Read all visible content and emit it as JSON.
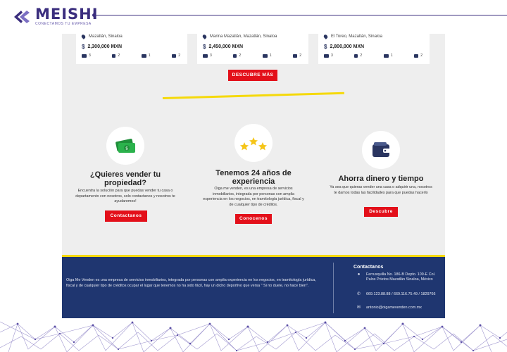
{
  "header": {
    "brand": "MEISHI",
    "tagline": "CONECTAMOS TU EMPRESA"
  },
  "properties": [
    {
      "location": "Mazatlán, Sinaloa",
      "price": "2,300,000 MXN",
      "bedrooms": "3",
      "bathrooms": "2",
      "garage": "1",
      "floors": "2"
    },
    {
      "location": "Marina Mazatlán, Mazatlán, Sinaloa",
      "price": "2,450,000 MXN",
      "bedrooms": "3",
      "bathrooms": "2",
      "garage": "1",
      "floors": "2"
    },
    {
      "location": "El Toreo, Mazatlán, Sinaloa",
      "price": "2,800,000 MXN",
      "bedrooms": "3",
      "bathrooms": "2",
      "garage": "1",
      "floors": "2"
    }
  ],
  "more_button": "DESCUBRE MÁS",
  "features": [
    {
      "icon": "money-icon",
      "title": "¿Quieres vender tu propiedad?",
      "text": "Encuentra la solución para que puedas vender tu casa o departamento con nosotros, solo contactanos y nosotros te ayudaremos!",
      "button": "Contactanos"
    },
    {
      "icon": "stars-icon",
      "title": "Tenemos 24 años de experiencia",
      "text": "Oiga me venden, es una empresa de servicios inmobiliarios, integrada por personas con amplia experiencia en los negocios, en tramitología jurídica, fiscal y de cualquier tipo de créditos.",
      "button": "Conocenos"
    },
    {
      "icon": "wallet-icon",
      "title": "Ahorra dinero y tiempo",
      "text": "Ya sea que quieras vender una casa o adquirir una, nosotros te damos todas las facilidades para que puedas hacerlo",
      "button": "Descubre"
    }
  ],
  "footer": {
    "about": "Oiga Me Venden es una empresa de servicios inmobiliarios, integrada por personas con amplia experiencia en los negocios, en tramitología jurídica, fiscal y de cualquier tipo de créditos ocupar el lugar que tenemos no ha sido fácil, hay un dicho deportivo que versa \" Si no duele, no hace bien\".",
    "contact_title": "Contactanos",
    "address": "Ferrusquilla No. 186-B Depto. 109-E Col. Palos Prietos Mazatlán Sinaloa, México",
    "phone": "669.123.88.88 / 669.116.75.49 / 1829766",
    "email": "antonio@oigamevenden.com.mx"
  },
  "colors": {
    "brand_purple": "#3b2e7e",
    "accent_red": "#e3101a",
    "accent_yellow": "#f5d90a",
    "footer_navy": "#1f3670"
  }
}
